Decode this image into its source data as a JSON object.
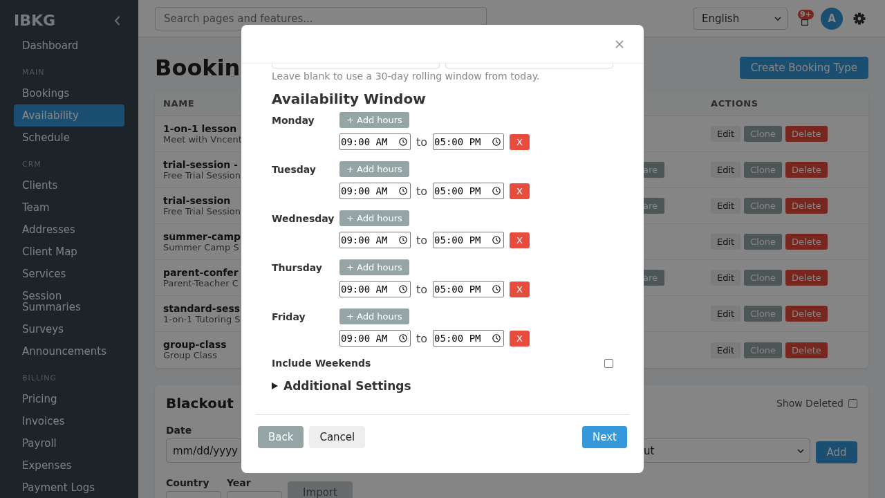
{
  "sidebar": {
    "brand": "IBKG",
    "sections": [
      {
        "items": [
          {
            "label": "Dashboard",
            "selected": false
          }
        ]
      },
      {
        "heading": "MAIN",
        "items": [
          {
            "label": "Bookings",
            "selected": false
          },
          {
            "label": "Availability",
            "selected": true
          },
          {
            "label": "Schedule",
            "selected": false
          }
        ]
      },
      {
        "heading": "CRM",
        "items": [
          {
            "label": "Clients",
            "selected": false
          },
          {
            "label": "Team",
            "selected": false
          },
          {
            "label": "Addresses",
            "selected": false
          },
          {
            "label": "Client Map",
            "selected": false
          },
          {
            "label": "Services",
            "selected": false
          },
          {
            "label": "Session Summaries",
            "selected": false
          },
          {
            "label": "Surveys",
            "selected": false
          },
          {
            "label": "Announcements",
            "selected": false
          }
        ]
      },
      {
        "heading": "BILLING",
        "items": [
          {
            "label": "Pricing",
            "selected": false
          },
          {
            "label": "Invoices",
            "selected": false
          },
          {
            "label": "Payroll",
            "selected": false
          },
          {
            "label": "Expenses",
            "selected": false
          },
          {
            "label": "Payment Logs",
            "selected": false
          }
        ]
      }
    ]
  },
  "top_bar": {
    "search": {
      "placeholder": "Search pages and features..."
    },
    "language": "English",
    "notification_badge": "9+",
    "avatar_initial": "A"
  },
  "page": {
    "title": "Bookin",
    "create_button": "Create Booking Type"
  },
  "table": {
    "columns": [
      "NAME",
      "ACTIONS"
    ],
    "rows": [
      {
        "name": "1-on-1 lesson",
        "description": "Meet with Vncent",
        "actions": [
          {
            "kind": "edit",
            "label": "Edit"
          },
          {
            "kind": "clone",
            "label": "Clone"
          },
          {
            "kind": "delete",
            "label": "Delete"
          }
        ]
      },
      {
        "name": "trial-session -",
        "description": "Free Trial Session",
        "share_button": "are",
        "actions": [
          {
            "kind": "edit",
            "label": "Edit"
          },
          {
            "kind": "clone",
            "label": "Clone"
          },
          {
            "kind": "delete",
            "label": "Delete"
          }
        ]
      },
      {
        "name": "trial-session",
        "description": "Free Trial Session",
        "share_button": "are",
        "actions": [
          {
            "kind": "edit",
            "label": "Edit"
          },
          {
            "kind": "clone",
            "label": "Clone"
          },
          {
            "kind": "delete",
            "label": "Delete"
          }
        ]
      },
      {
        "name": "summer-camp",
        "description": "Summer Camp S",
        "actions": [
          {
            "kind": "edit",
            "label": "Edit"
          },
          {
            "kind": "clone",
            "label": "Clone"
          },
          {
            "kind": "delete",
            "label": "Delete"
          }
        ]
      },
      {
        "name": "parent-confer",
        "description": "Parent-Teacher C",
        "share_button": "are",
        "actions": [
          {
            "kind": "edit",
            "label": "Edit"
          },
          {
            "kind": "clone",
            "label": "Clone"
          },
          {
            "kind": "delete",
            "label": "Delete"
          }
        ]
      },
      {
        "name": "standard-sess",
        "description": "1-on-1 Tutoring S",
        "actions": [
          {
            "kind": "edit",
            "label": "Edit"
          },
          {
            "kind": "clone",
            "label": "Clone"
          },
          {
            "kind": "delete",
            "label": "Delete"
          }
        ]
      },
      {
        "name": "group-class",
        "description": "Group Class",
        "actions": [
          {
            "kind": "edit",
            "label": "Edit"
          },
          {
            "kind": "clone",
            "label": "Clone"
          },
          {
            "kind": "delete",
            "label": "Delete"
          }
        ]
      }
    ]
  },
  "blackout": {
    "title": "Blackout",
    "show_deleted": {
      "label": "Show Deleted",
      "checked": false
    },
    "date": {
      "label": "Date",
      "placeholder": "mm/dd/yyyy"
    },
    "reason_select": "ut",
    "add_button": "Add",
    "country": {
      "label": "Country"
    },
    "year": {
      "label": "Year"
    },
    "import_button": {
      "label": "Import",
      "disabled": true
    }
  },
  "modal": {
    "help_text": "Leave blank to use a 30-day rolling window from today.",
    "section_title": "Availability Window",
    "days": [
      {
        "name": "Monday",
        "add_button": "+ Add hours",
        "slots": [
          {
            "start": "09:00 AM",
            "separator": "to",
            "end": "05:00 PM",
            "remove": "X"
          }
        ]
      },
      {
        "name": "Tuesday",
        "add_button": "+ Add hours",
        "slots": [
          {
            "start": "09:00 AM",
            "separator": "to",
            "end": "05:00 PM",
            "remove": "X"
          }
        ]
      },
      {
        "name": "Wednesday",
        "add_button": "+ Add hours",
        "slots": [
          {
            "start": "09:00 AM",
            "separator": "to",
            "end": "05:00 PM",
            "remove": "X"
          }
        ]
      },
      {
        "name": "Thursday",
        "add_button": "+ Add hours",
        "slots": [
          {
            "start": "09:00 AM",
            "separator": "to",
            "end": "05:00 PM",
            "remove": "X"
          }
        ]
      },
      {
        "name": "Friday",
        "add_button": "+ Add hours",
        "slots": [
          {
            "start": "09:00 AM",
            "separator": "to",
            "end": "05:00 PM",
            "remove": "X"
          }
        ]
      }
    ],
    "include_weekends": {
      "label": "Include Weekends",
      "checked": false
    },
    "additional_settings": {
      "label": "Additional Settings",
      "expanded": false
    },
    "footer_buttons": [
      {
        "kind": "secondary",
        "label": "Back"
      },
      {
        "kind": "light",
        "label": "Cancel"
      },
      {
        "kind": "primary",
        "label": "Next"
      }
    ]
  }
}
